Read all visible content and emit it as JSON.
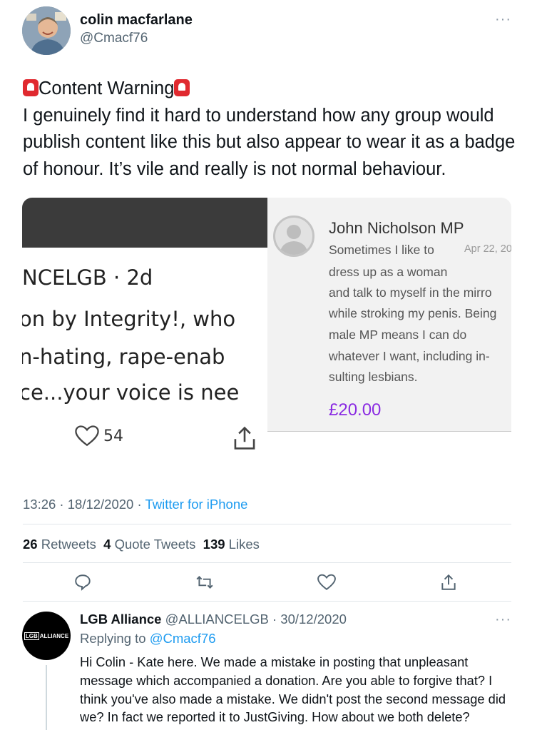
{
  "tweet": {
    "author_name": "colin macfarlane",
    "author_handle": "@Cmacf76",
    "more": "···",
    "text_line1": "Content Warning",
    "text_body": "I genuinely find it hard to understand how any group would publish content like this but also appear to wear it as a badge of honour.  It’s vile and really is not normal behaviour.",
    "timestamp": "13:26 · 18/12/2020 · ",
    "source": "Twitter for iPhone",
    "stats": {
      "retweets_count": "26",
      "retweets_label": "Retweets",
      "quotes_count": "4",
      "quotes_label": "Quote Tweets",
      "likes_count": "139",
      "likes_label": "Likes"
    }
  },
  "image_left": {
    "line1": "NCELGB · 2d",
    "line2": "on by Integrity!, who",
    "line3": "n-hating, rape-enab",
    "line4": "ce...your voice is nee",
    "likes": "54"
  },
  "image_right": {
    "name": "John Nicholson MP",
    "date": "Apr 22, 20",
    "lines": [
      "Sometimes I like to",
      "dress up as a woman",
      "and talk to myself in the mirro",
      "while stroking my penis. Being",
      "male MP means I can do",
      "whatever I want, including in-",
      "sulting lesbians."
    ],
    "amount": "£20.00"
  },
  "reply": {
    "author_name": "LGB Alliance",
    "author_handle": "@ALLIANCELGB",
    "date": "· 30/12/2020",
    "more": "···",
    "replying_prefix": "Replying to ",
    "replying_to": "@Cmacf76",
    "avatar_logo_boxed": "LGB",
    "avatar_logo_text": "ALLIANCE",
    "body": "Hi Colin - Kate here. We made a mistake in posting that unpleasant message which accompanied a donation. Are you able to forgive that? I think you've also made a mistake.  We didn't post the second message did we? In fact we reported it to JustGiving. How about we both delete?"
  },
  "colors": {
    "link_blue": "#1d9bf0",
    "secondary_text": "#536471",
    "amount_purple": "#8a2be2",
    "siren_red": "#e0292f"
  },
  "icons": [
    "siren-icon",
    "heart-icon",
    "share-icon",
    "reply-icon",
    "retweet-icon",
    "like-icon",
    "more-icon",
    "person-placeholder-icon"
  ]
}
